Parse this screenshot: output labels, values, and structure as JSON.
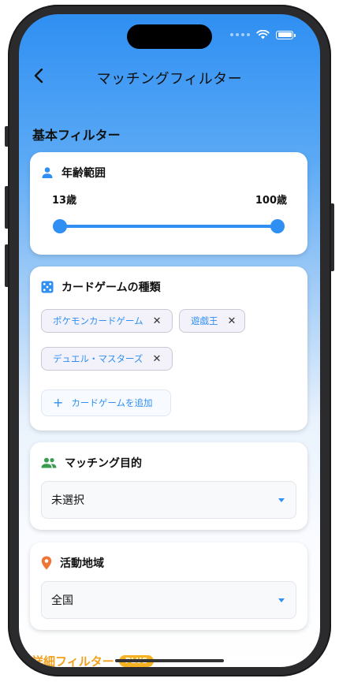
{
  "nav": {
    "title": "マッチングフィルター",
    "back_icon": "chevron-left-icon"
  },
  "section": {
    "basic": "基本フィルター",
    "advanced": "詳細フィルター",
    "advanced_badge": "PLUS"
  },
  "age": {
    "label": "年齢範囲",
    "min": "13歳",
    "max": "100歳",
    "min_value": 13,
    "max_value": 100
  },
  "games": {
    "label": "カードゲームの種類",
    "chips": [
      "ポケモンカードゲーム",
      "遊戯王",
      "デュエル・マスターズ"
    ],
    "remove_glyph": "✕",
    "add_label": "カードゲームを追加",
    "add_glyph": "+"
  },
  "purpose": {
    "label": "マッチング目的",
    "value": "未選択"
  },
  "region": {
    "label": "活動地域",
    "value": "全国"
  },
  "colors": {
    "accent": "#2f8ff2",
    "people": "#3b9b4f",
    "pin": "#f07535",
    "plus": "#f5b324"
  }
}
